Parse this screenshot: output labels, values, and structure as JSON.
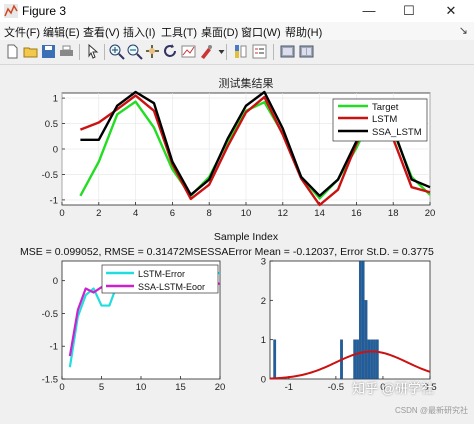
{
  "window": {
    "title": "Figure 3",
    "minimize": "—",
    "maximize": "☐",
    "close": "✕"
  },
  "menu": [
    "文件(F)",
    "编辑(E)",
    "查看(V)",
    "插入(I)",
    "工具(T)",
    "桌面(D)",
    "窗口(W)",
    "帮助(H)"
  ],
  "menu_pin": "↘",
  "toolbar": [
    "new-figure-icon",
    "open-icon",
    "save-icon",
    "print-icon",
    "pointer-icon",
    "zoom-in-icon",
    "zoom-out-icon",
    "pan-icon",
    "rotate-icon",
    "data-cursor-icon",
    "brush-icon",
    "colorbar-icon",
    "legend-icon",
    "hide-plottools-icon",
    "show-plottools-icon"
  ],
  "colors": {
    "target": "#22dd22",
    "lstm": "#cc1111",
    "ssa": "#000000",
    "lstm_err": "#22dddd",
    "ssa_err": "#cc22cc",
    "hist": "#1f5f9f",
    "pdf": "#cc1111"
  },
  "summary_text": "MSE = 0.099052, RMSE = 0.31472MSESSAError Mean = -0.12037, Error St.D. = 0.3775",
  "watermark": "知乎 @研学社",
  "watermark_small": "CSDN @最新研究社",
  "chart_data": [
    {
      "type": "line",
      "title": "测试集结果",
      "xlabel": "Sample Index",
      "ylabel": "",
      "xlim": [
        0,
        20
      ],
      "ylim": [
        -1.1,
        1.1
      ],
      "xticks": [
        "0",
        "2",
        "4",
        "6",
        "8",
        "10",
        "12",
        "14",
        "16",
        "18",
        "20"
      ],
      "yticks": [
        "-1",
        "-0.5",
        "0",
        "0.5",
        "1"
      ],
      "grid": true,
      "legend_position": "top-right",
      "x": [
        1,
        2,
        3,
        4,
        5,
        6,
        7,
        8,
        9,
        10,
        11,
        12,
        13,
        14,
        15,
        16,
        17,
        18,
        19,
        20
      ],
      "series": [
        {
          "name": "Target",
          "values": [
            -0.92,
            -0.25,
            0.68,
            0.93,
            0.42,
            -0.4,
            -0.92,
            -0.55,
            0.15,
            0.75,
            0.92,
            0.3,
            -0.55,
            -0.97,
            -0.6,
            0.02,
            0.78,
            0.35,
            -0.55,
            -0.9
          ]
        },
        {
          "name": "LSTM",
          "values": [
            0.38,
            0.52,
            0.78,
            1.05,
            0.75,
            -0.3,
            -0.98,
            -0.7,
            0.05,
            0.72,
            1.02,
            0.28,
            -0.58,
            -1.1,
            -0.8,
            0.1,
            0.8,
            0.2,
            -0.75,
            -0.85
          ]
        },
        {
          "name": "SSA_LSTM",
          "values": [
            0.18,
            0.18,
            0.85,
            1.12,
            0.9,
            -0.25,
            -0.9,
            -0.6,
            0.2,
            0.85,
            1.12,
            0.4,
            -0.55,
            -0.92,
            -0.6,
            0.15,
            0.9,
            0.4,
            -0.6,
            -0.75
          ]
        }
      ]
    },
    {
      "type": "line",
      "xlim": [
        0,
        20
      ],
      "ylim": [
        -1.5,
        0.3
      ],
      "xticks": [
        "0",
        "5",
        "10",
        "15",
        "20"
      ],
      "yticks": [
        "-1.5",
        "-1",
        "-0.5",
        "0"
      ],
      "legend_position": "top-right",
      "x": [
        1,
        2,
        3,
        4,
        5,
        6,
        7,
        8,
        9,
        10,
        11,
        12,
        13,
        14,
        15,
        16,
        17,
        18,
        19,
        20
      ],
      "series": [
        {
          "name": "LSTM-Error",
          "values": [
            -1.32,
            -0.55,
            -0.22,
            -0.12,
            -0.38,
            -0.38,
            -0.05,
            -0.12,
            -0.14,
            -0.12,
            -0.1,
            -0.1,
            -0.12,
            -0.08,
            -0.12,
            -0.1,
            -0.08,
            -0.04,
            0.1,
            0.12
          ]
        },
        {
          "name": "SSA-LSTM-Eoor",
          "values": [
            -1.15,
            -0.45,
            -0.12,
            -0.18,
            -0.1,
            -0.15,
            -0.1,
            -0.05,
            -0.12,
            -0.1,
            -0.08,
            -0.06,
            -0.1,
            -0.12,
            -0.05,
            -0.08,
            -0.03,
            -0.12,
            -0.02,
            -0.05
          ]
        }
      ]
    },
    {
      "type": "bar",
      "xlim": [
        -1.2,
        0.5
      ],
      "ylim": [
        0,
        3
      ],
      "xticks": [
        "-1",
        "-0.5",
        "0",
        "0.5"
      ],
      "yticks": [
        "0",
        "1",
        "2",
        "3"
      ],
      "bins": [
        {
          "x": -1.15,
          "count": 1
        },
        {
          "x": -0.44,
          "count": 1
        },
        {
          "x": -0.3,
          "count": 1
        },
        {
          "x": -0.27,
          "count": 1
        },
        {
          "x": -0.24,
          "count": 3
        },
        {
          "x": -0.21,
          "count": 3
        },
        {
          "x": -0.18,
          "count": 2
        },
        {
          "x": -0.15,
          "count": 1
        },
        {
          "x": -0.12,
          "count": 1
        },
        {
          "x": -0.09,
          "count": 1
        },
        {
          "x": -0.06,
          "count": 1
        }
      ],
      "fit": {
        "mean": -0.12037,
        "std": 0.3775,
        "scale": 0.7
      }
    }
  ]
}
